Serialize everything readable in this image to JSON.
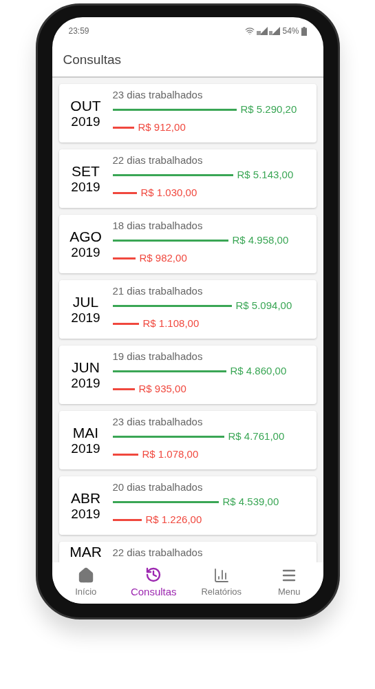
{
  "status_bar": {
    "time": "23:59",
    "battery": "54%"
  },
  "app_bar": {
    "title": "Consultas"
  },
  "months": [
    {
      "month": "OUT",
      "year": "2019",
      "days": "23 dias trabalhados",
      "income": {
        "amount": "R$ 5.290,20"
      },
      "expense": {
        "amount": "R$ 912,00"
      }
    },
    {
      "month": "SET",
      "year": "2019",
      "days": "22 dias trabalhados",
      "income": {
        "amount": "R$ 5.143,00"
      },
      "expense": {
        "amount": "R$ 1.030,00"
      }
    },
    {
      "month": "AGO",
      "year": "2019",
      "days": "18 dias trabalhados",
      "income": {
        "amount": "R$ 4.958,00"
      },
      "expense": {
        "amount": "R$ 982,00"
      }
    },
    {
      "month": "JUL",
      "year": "2019",
      "days": "21 dias trabalhados",
      "income": {
        "amount": "R$ 5.094,00"
      },
      "expense": {
        "amount": "R$ 1.108,00"
      }
    },
    {
      "month": "JUN",
      "year": "2019",
      "days": "19 dias trabalhados",
      "income": {
        "amount": "R$ 4.860,00"
      },
      "expense": {
        "amount": "R$ 935,00"
      }
    },
    {
      "month": "MAI",
      "year": "2019",
      "days": "23 dias trabalhados",
      "income": {
        "amount": "R$ 4.761,00"
      },
      "expense": {
        "amount": "R$ 1.078,00"
      }
    },
    {
      "month": "ABR",
      "year": "2019",
      "days": "20 dias trabalhados",
      "income": {
        "amount": "R$ 4.539,00"
      },
      "expense": {
        "amount": "R$ 1.226,00"
      }
    },
    {
      "month": "MAR",
      "days": "22 dias trabalhados"
    }
  ],
  "nav": [
    {
      "label": "Início",
      "kind": "home",
      "selected": false
    },
    {
      "label": "Consultas",
      "kind": "history",
      "selected": true
    },
    {
      "label": "Relatórios",
      "kind": "chart",
      "selected": false
    },
    {
      "label": "Menu",
      "kind": "menu",
      "selected": false
    }
  ]
}
